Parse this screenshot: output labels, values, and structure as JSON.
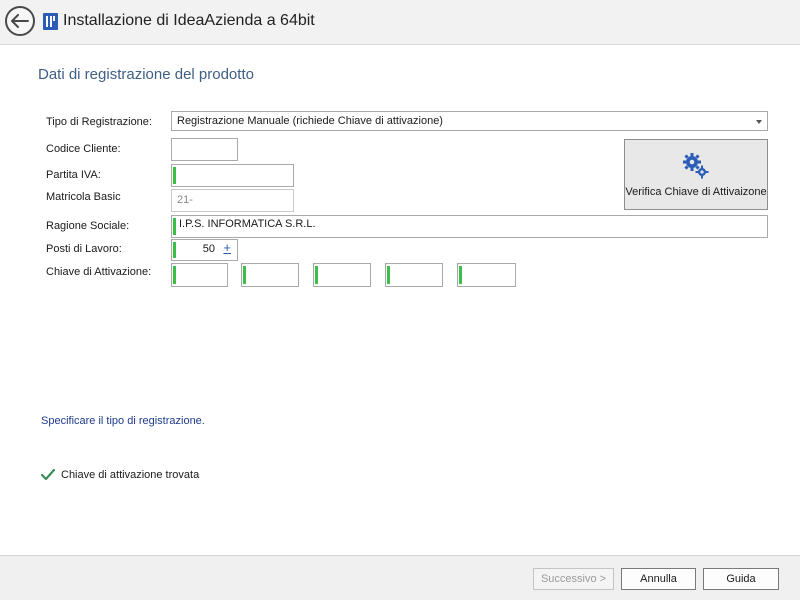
{
  "window": {
    "title": "Installazione di IdeaAzienda a 64bit"
  },
  "section": {
    "title": "Dati di registrazione del prodotto"
  },
  "form": {
    "tipo_registrazione": {
      "label": "Tipo di Registrazione:",
      "value": "Registrazione Manuale (richiede Chiave di attivazione)"
    },
    "codice_cliente": {
      "label": "Codice Cliente:",
      "value": ""
    },
    "partita_iva": {
      "label": "Partita IVA:",
      "value": ""
    },
    "matricola_basic": {
      "label": "Matricola Basic",
      "value": "21-"
    },
    "ragione_sociale": {
      "label": "Ragione Sociale:",
      "value": "I.P.S. INFORMATICA S.R.L."
    },
    "posti_lavoro": {
      "label": "Posti di Lavoro:",
      "value": "50",
      "plus": "+"
    },
    "chiave_attivazione": {
      "label": "Chiave di Attivazione:",
      "segments": [
        "",
        "",
        "",
        "",
        ""
      ]
    }
  },
  "verify_button": {
    "label": "Verifica Chiave di Attivaizone",
    "icon": "gears-icon",
    "icon_color": "#2b5db8"
  },
  "hint": "Specificare il tipo di registrazione.",
  "status": {
    "text": "Chiave di attivazione trovata",
    "icon": "check-icon",
    "color": "#3c8c5a"
  },
  "footer": {
    "next_label": "Successivo >",
    "cancel_label": "Annulla",
    "help_label": "Guida"
  },
  "colors": {
    "required_marker": "#3cbf48",
    "section_title": "#3f5f85",
    "hint": "#1f3b8c"
  }
}
